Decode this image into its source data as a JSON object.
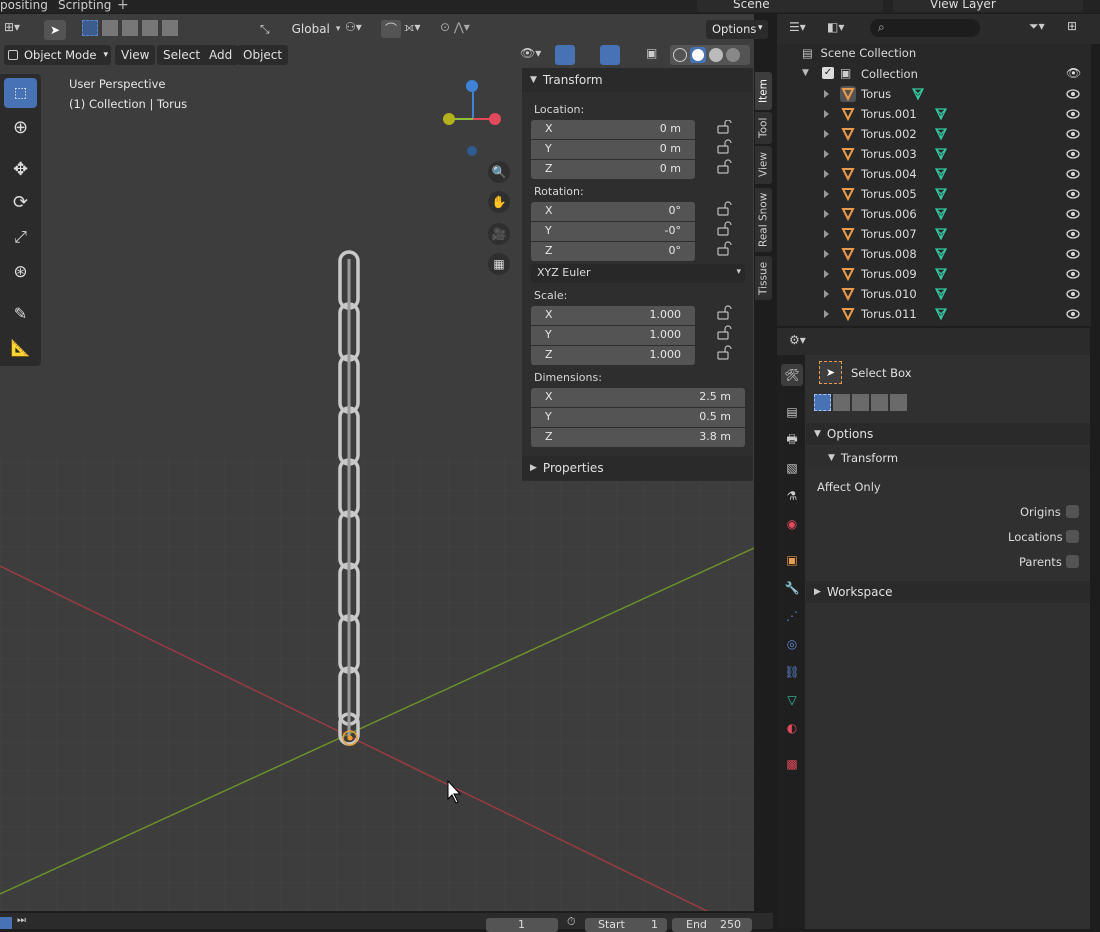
{
  "workspace_tabs": {
    "compositing": "positing",
    "scripting": "Scripting",
    "add": "+"
  },
  "scene": {
    "name": "Scene",
    "view_layer": "View Layer"
  },
  "header": {
    "orientation": "Global",
    "options_label": "Options"
  },
  "menu": {
    "mode": "Object Mode",
    "view": "View",
    "select": "Select",
    "add": "Add",
    "object": "Object"
  },
  "viewport": {
    "perspective": "User Perspective",
    "context": "(1) Collection | Torus"
  },
  "n_panel": {
    "transform_title": "Transform",
    "location_label": "Location:",
    "location": [
      {
        "axis": "X",
        "value": "0 m"
      },
      {
        "axis": "Y",
        "value": "0 m"
      },
      {
        "axis": "Z",
        "value": "0 m"
      }
    ],
    "rotation_label": "Rotation:",
    "rotation": [
      {
        "axis": "X",
        "value": "0°"
      },
      {
        "axis": "Y",
        "value": "-0°"
      },
      {
        "axis": "Z",
        "value": "0°"
      }
    ],
    "rotation_mode": "XYZ Euler",
    "scale_label": "Scale:",
    "scale": [
      {
        "axis": "X",
        "value": "1.000"
      },
      {
        "axis": "Y",
        "value": "1.000"
      },
      {
        "axis": "Z",
        "value": "1.000"
      }
    ],
    "dimensions_label": "Dimensions:",
    "dimensions": [
      {
        "axis": "X",
        "value": "2.5 m"
      },
      {
        "axis": "Y",
        "value": "0.5 m"
      },
      {
        "axis": "Z",
        "value": "3.8 m"
      }
    ],
    "properties_title": "Properties",
    "tabs": [
      "Item",
      "Tool",
      "View",
      "Real Snow",
      "Tissue"
    ]
  },
  "outliner": {
    "root": "Scene Collection",
    "collection": "Collection",
    "items": [
      "Torus",
      "Torus.001",
      "Torus.002",
      "Torus.003",
      "Torus.004",
      "Torus.005",
      "Torus.006",
      "Torus.007",
      "Torus.008",
      "Torus.009",
      "Torus.010",
      "Torus.011"
    ]
  },
  "properties": {
    "tool_name": "Select Box",
    "options": "Options",
    "transform": "Transform",
    "affect_only": "Affect Only",
    "origins": "Origins",
    "locations": "Locations",
    "parents": "Parents",
    "workspace": "Workspace"
  },
  "timeline": {
    "frame": "1",
    "start_label": "Start",
    "start": "1",
    "end_label": "End",
    "end": "250"
  },
  "colors": {
    "x_axis": "#e24a5b",
    "y_axis": "#8fbe3a",
    "z_axis": "#3f83d8",
    "accent": "#4772b3",
    "mesh_icon": "#e99a4a",
    "data_icon": "#34c8a0"
  }
}
